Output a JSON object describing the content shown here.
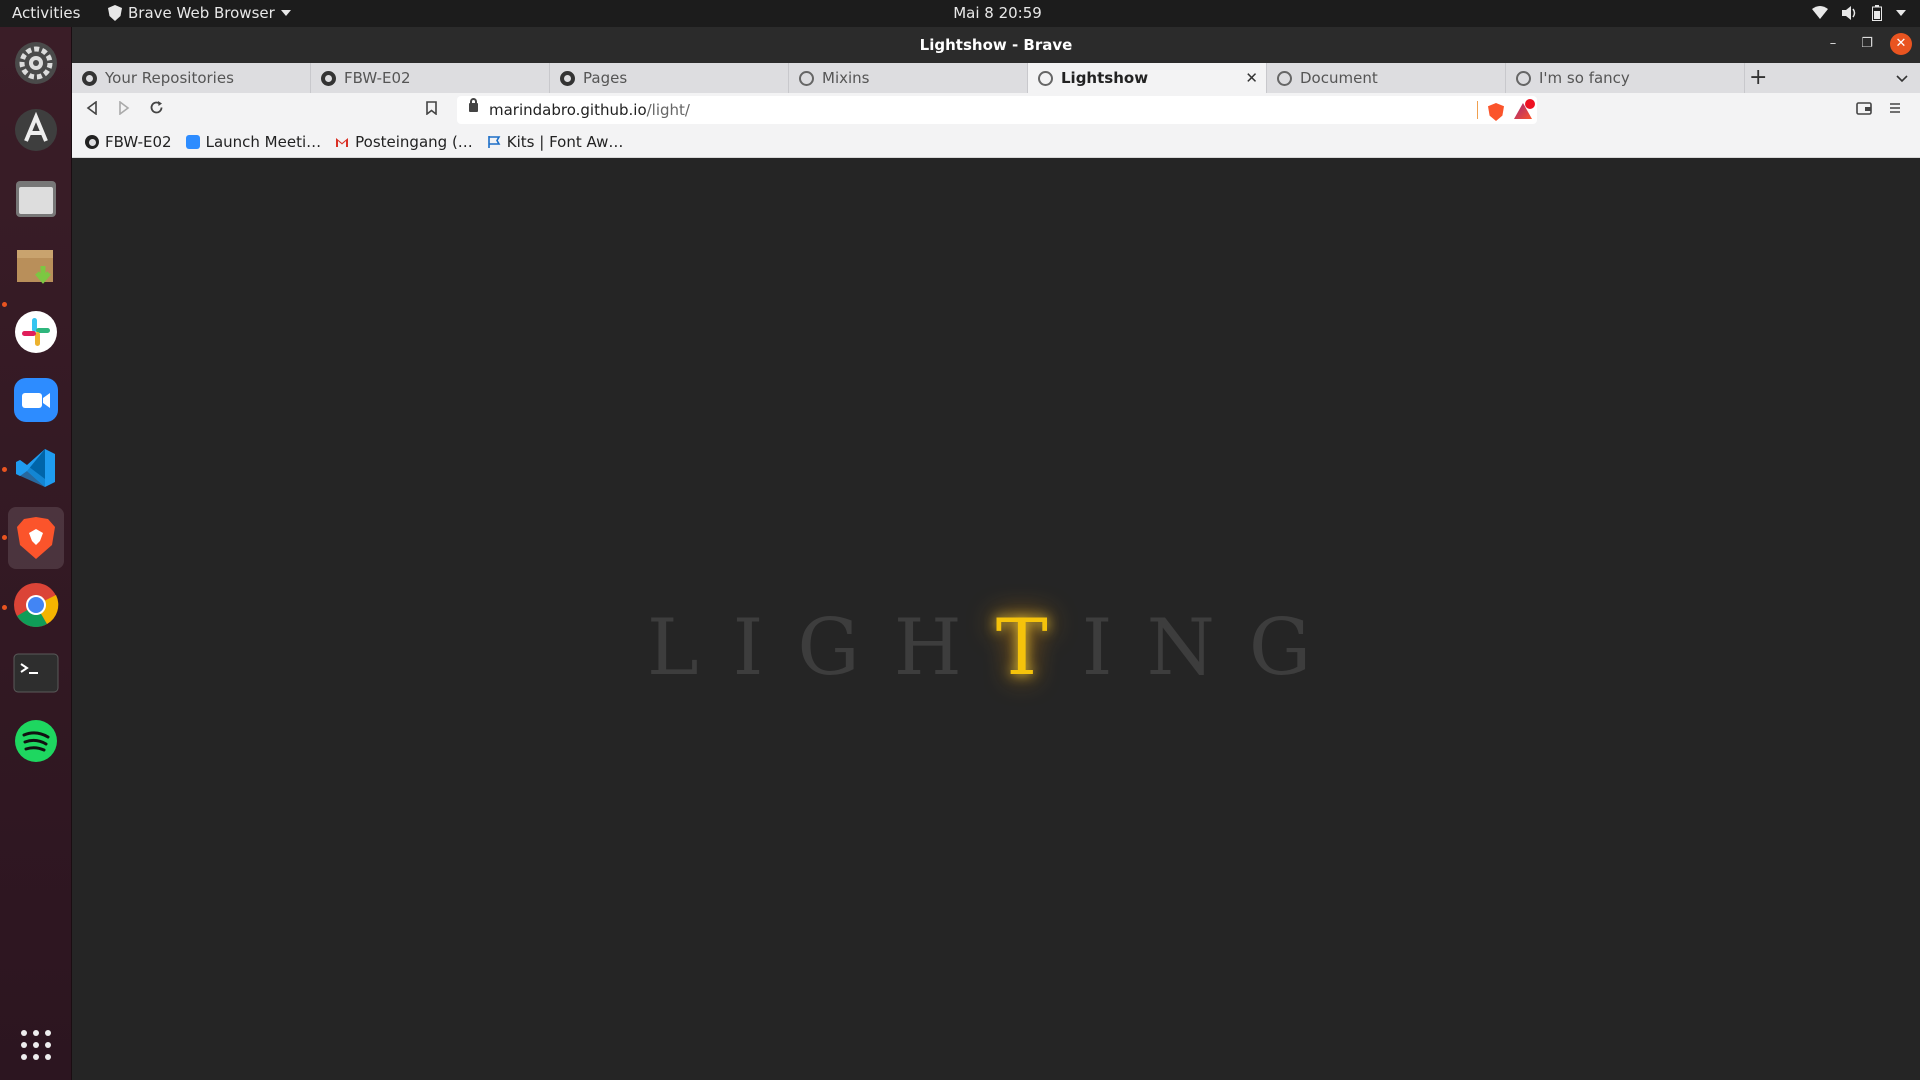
{
  "topbar": {
    "activities": "Activities",
    "app_name": "Brave Web Browser",
    "clock": "Mai 8  20:59"
  },
  "dock": {
    "apps": [
      {
        "name": "Settings",
        "icon": "settings-icon"
      },
      {
        "name": "Ubuntu Software",
        "icon": "software-center-icon"
      },
      {
        "name": "Files",
        "icon": "files-icon"
      },
      {
        "name": "Archive Manager",
        "icon": "archive-icon"
      },
      {
        "name": "Slack",
        "icon": "slack-icon"
      },
      {
        "name": "Zoom",
        "icon": "zoom-icon"
      },
      {
        "name": "Visual Studio Code",
        "icon": "vscode-icon"
      },
      {
        "name": "Brave",
        "icon": "brave-icon"
      },
      {
        "name": "Google Chrome",
        "icon": "chrome-icon"
      },
      {
        "name": "Terminal",
        "icon": "terminal-icon"
      },
      {
        "name": "Spotify",
        "icon": "spotify-icon"
      }
    ],
    "show_apps": "apps-grid-icon"
  },
  "window": {
    "title": "Lightshow - Brave"
  },
  "tabs": [
    {
      "label": "Your Repositories",
      "icon": "github-icon"
    },
    {
      "label": "FBW-E02",
      "icon": "github-icon"
    },
    {
      "label": "Pages",
      "icon": "github-icon"
    },
    {
      "label": "Mixins",
      "icon": "globe-icon"
    },
    {
      "label": "Lightshow",
      "icon": "globe-icon",
      "active": true
    },
    {
      "label": "Document",
      "icon": "globe-icon"
    },
    {
      "label": "I'm so fancy",
      "icon": "globe-icon"
    }
  ],
  "toolbar": {
    "url_host": "marindabro.github.io",
    "url_path": "/light/"
  },
  "bookmarks": [
    {
      "label": "FBW-E02",
      "icon": "github-icon"
    },
    {
      "label": "Launch Meeti…",
      "icon": "zoom-icon"
    },
    {
      "label": "Posteingang (…",
      "icon": "gmail-icon"
    },
    {
      "label": "Kits | Font Aw…",
      "icon": "fontawesome-flag-icon"
    }
  ],
  "page": {
    "word_before": "LIGH",
    "word_lit": "T",
    "word_after": "ING",
    "lit_color": "#f5c30b",
    "dim_color": "#3d3d3d"
  }
}
